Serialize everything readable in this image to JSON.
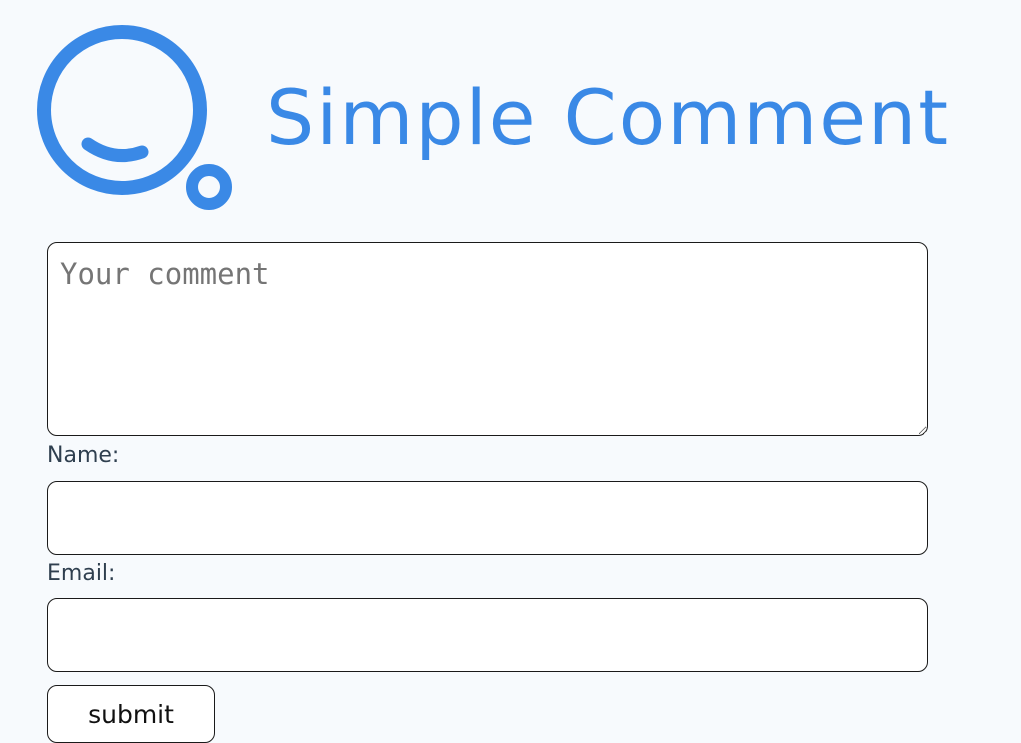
{
  "brand": {
    "title": "Simple Comment",
    "accent_color": "#3a89e6",
    "logo_icon": "speech-bubble-smile-icon"
  },
  "form": {
    "comment_placeholder": "Your comment",
    "comment_value": "",
    "name_label": "Name:",
    "name_value": "",
    "email_label": "Email:",
    "email_value": "",
    "submit_label": "submit"
  }
}
